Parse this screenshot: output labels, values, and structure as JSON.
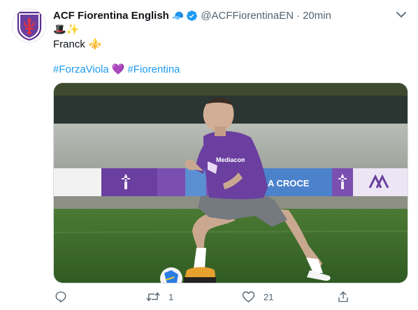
{
  "account": {
    "display_name": "ACF Fiorentina English",
    "badge_emoji": "🧢",
    "handle": "@ACFFiorentinaEN",
    "separator": "·",
    "time": "20min",
    "avatar_icon": "fiorentina-crest-icon",
    "verified_icon": "verified-badge-icon"
  },
  "tweet": {
    "line1_emojis": "🎩✨",
    "line2_text": "Franck",
    "line2_emoji": "⚜️",
    "hashtag1": "#ForzaViola",
    "heart_emoji": "💜",
    "hashtag2": "#Fiorentina",
    "shirt_sponsor": "Mediacom",
    "banner_text": "A CROCE"
  },
  "actions": {
    "reply_count": "",
    "retweet_count": "1",
    "like_count": "21"
  },
  "colors": {
    "accent_blue": "#1d9bf0",
    "viola": "#6a3fa0",
    "muted": "#536471"
  }
}
